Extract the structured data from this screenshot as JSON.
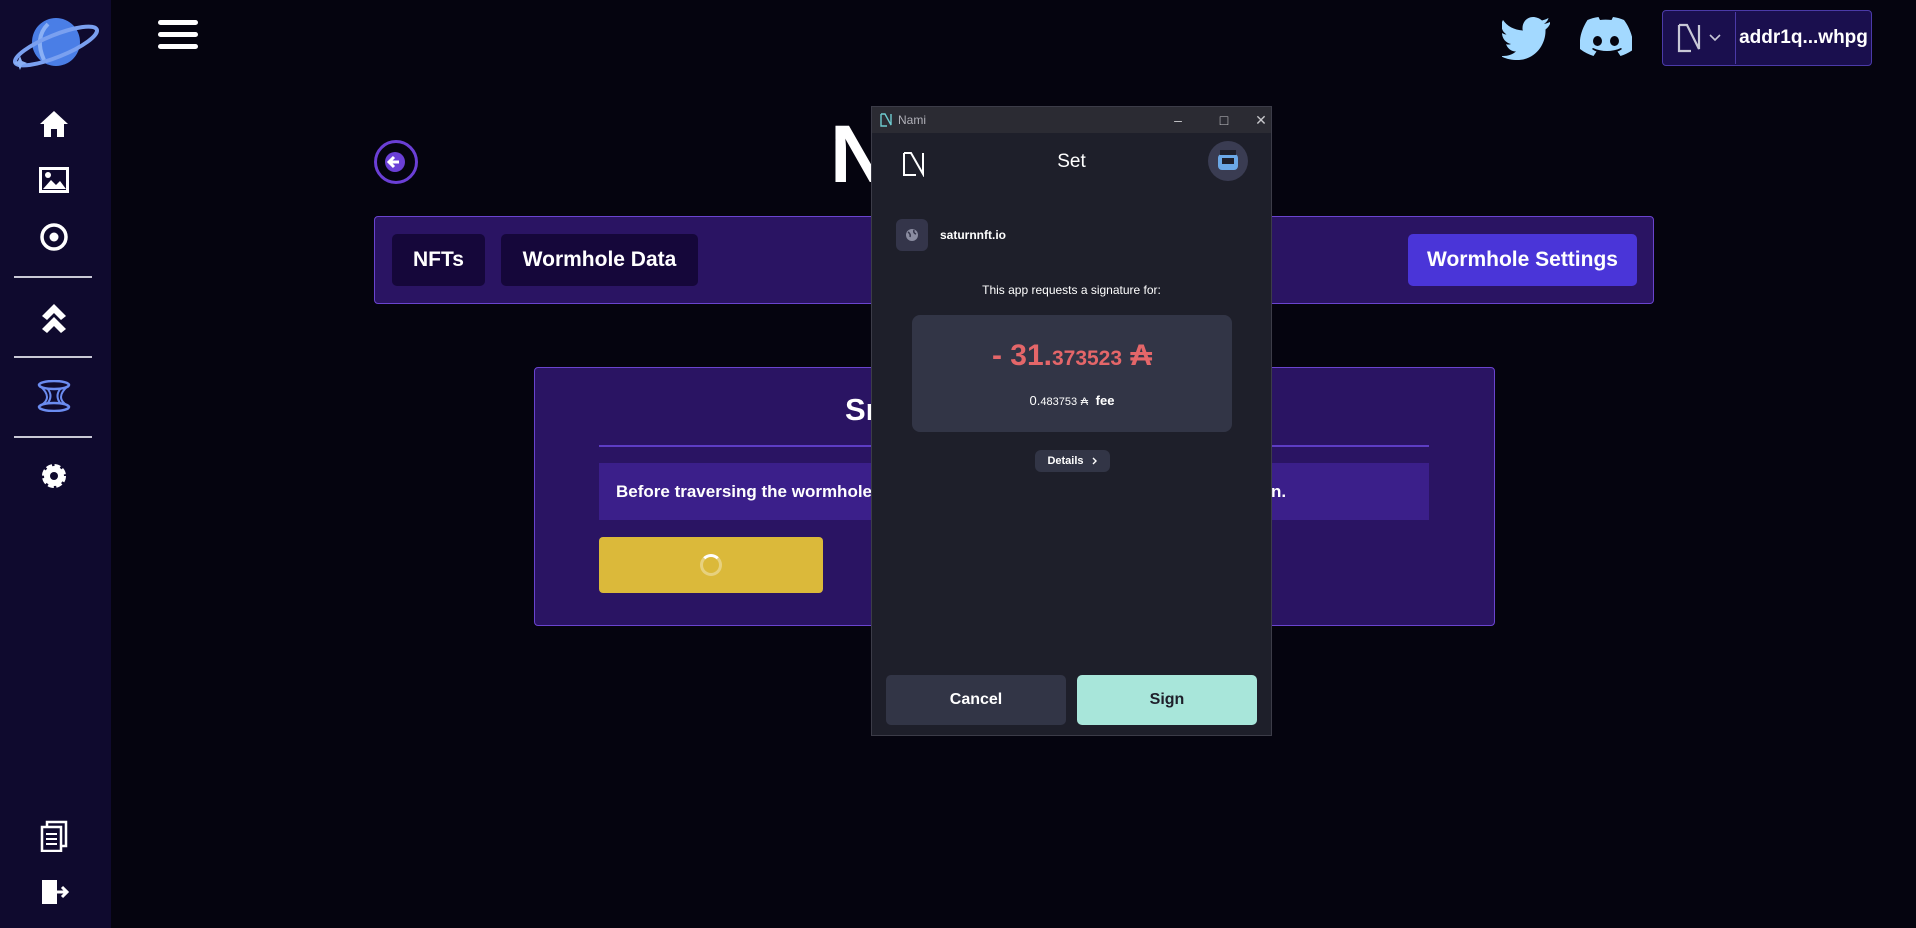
{
  "header": {
    "wallet_address": "addr1q...whpg"
  },
  "page": {
    "title": "N",
    "tabs": [
      {
        "label": "NFTs"
      },
      {
        "label": "Wormhole Data"
      },
      {
        "label": "Wormhole Settings"
      }
    ],
    "card": {
      "title": "Sn",
      "note_start": "Before traversing the wormhole, a",
      "note_end": "n."
    }
  },
  "popup": {
    "window_title": "Nami",
    "header_title": "Set",
    "origin": "saturnnft.io",
    "request_text": "This app requests a signature for:",
    "amount_main": "- 31.",
    "amount_decimals": "373523",
    "currency_symbol": "₳",
    "fee_int": "0.",
    "fee_decimals": "483753",
    "fee_label": "fee",
    "details_label": "Details",
    "cancel_label": "Cancel",
    "sign_label": "Sign"
  },
  "colors": {
    "background": "#05040f",
    "sidebar": "#0f0a2e",
    "accent_purple": "#4a35d8",
    "card_purple": "#2a1463",
    "loader_yellow": "#dbb93a",
    "amount_red": "#e46669",
    "sign_button": "#a8e6da"
  },
  "icons": [
    "saturn-logo",
    "home-icon",
    "image-icon",
    "circle-dot-icon",
    "chevrons-up-icon",
    "wormhole-icon",
    "gear-icon",
    "documents-icon",
    "logout-icon",
    "twitter-icon",
    "discord-icon",
    "nami-logo-icon",
    "globe-icon",
    "avatar-icon"
  ]
}
